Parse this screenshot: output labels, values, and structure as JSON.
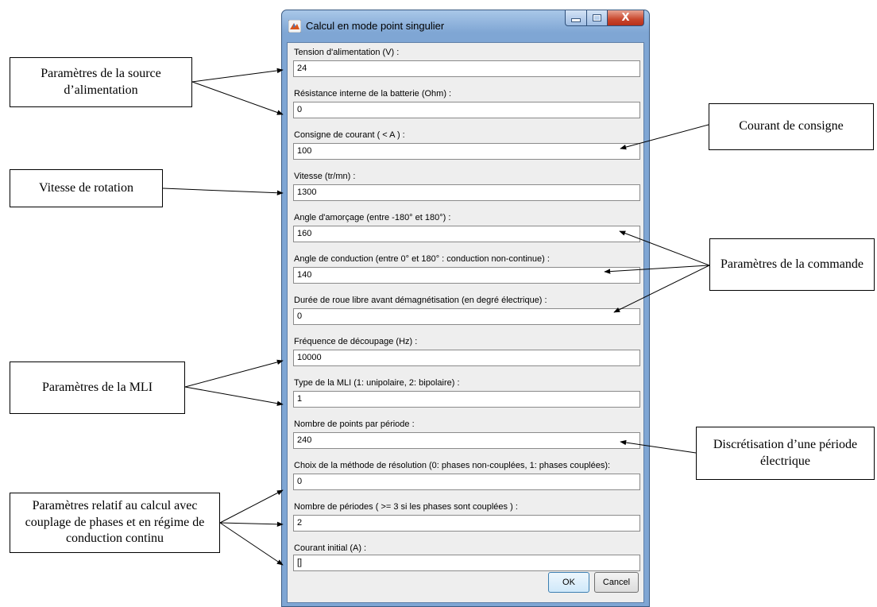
{
  "window": {
    "title": "Calcul en mode point singulier",
    "controls": {
      "minimize": "minimize-icon",
      "maximize": "maximize-icon",
      "close": "close-icon"
    },
    "accent": "#7fa6d4"
  },
  "fields": [
    {
      "label": "Tension d'alimentation (V) :",
      "value": "24"
    },
    {
      "label": "Résistance interne de la batterie (Ohm) :",
      "value": "0"
    },
    {
      "label": "Consigne de courant ( < A ) :",
      "value": "100"
    },
    {
      "label": "Vitesse (tr/mn) :",
      "value": "1300"
    },
    {
      "label": "Angle d'amorçage (entre -180° et 180°) :",
      "value": "160"
    },
    {
      "label": "Angle de conduction (entre 0° et 180° : conduction non-continue) :",
      "value": "140"
    },
    {
      "label": "Durée de roue libre avant démagnétisation (en degré électrique) :",
      "value": "0"
    },
    {
      "label": "Fréquence de découpage (Hz) :",
      "value": "10000"
    },
    {
      "label": "Type de la MLI (1: unipolaire, 2: bipolaire) :",
      "value": "1"
    },
    {
      "label": "Nombre de points par période :",
      "value": "240"
    },
    {
      "label": "Choix de la méthode de résolution (0: phases non-couplées, 1: phases couplées):",
      "value": "0"
    },
    {
      "label": "Nombre de périodes ( >= 3 si les phases sont couplées ) :",
      "value": "2"
    },
    {
      "label": "Courant initial (A) :",
      "value": "[]"
    }
  ],
  "buttons": {
    "ok": "OK",
    "cancel": "Cancel"
  },
  "callouts": {
    "source": "Paramètres de la source d’alimentation",
    "consigne": "Courant de consigne",
    "vitesse": "Vitesse de rotation",
    "commande": "Paramètres de la commande",
    "mli": "Paramètres de la MLI",
    "discretisation": "Discrétisation d’une période électrique",
    "calcul": "Paramètres relatif au calcul avec couplage de phases et en régime de conduction continu"
  }
}
